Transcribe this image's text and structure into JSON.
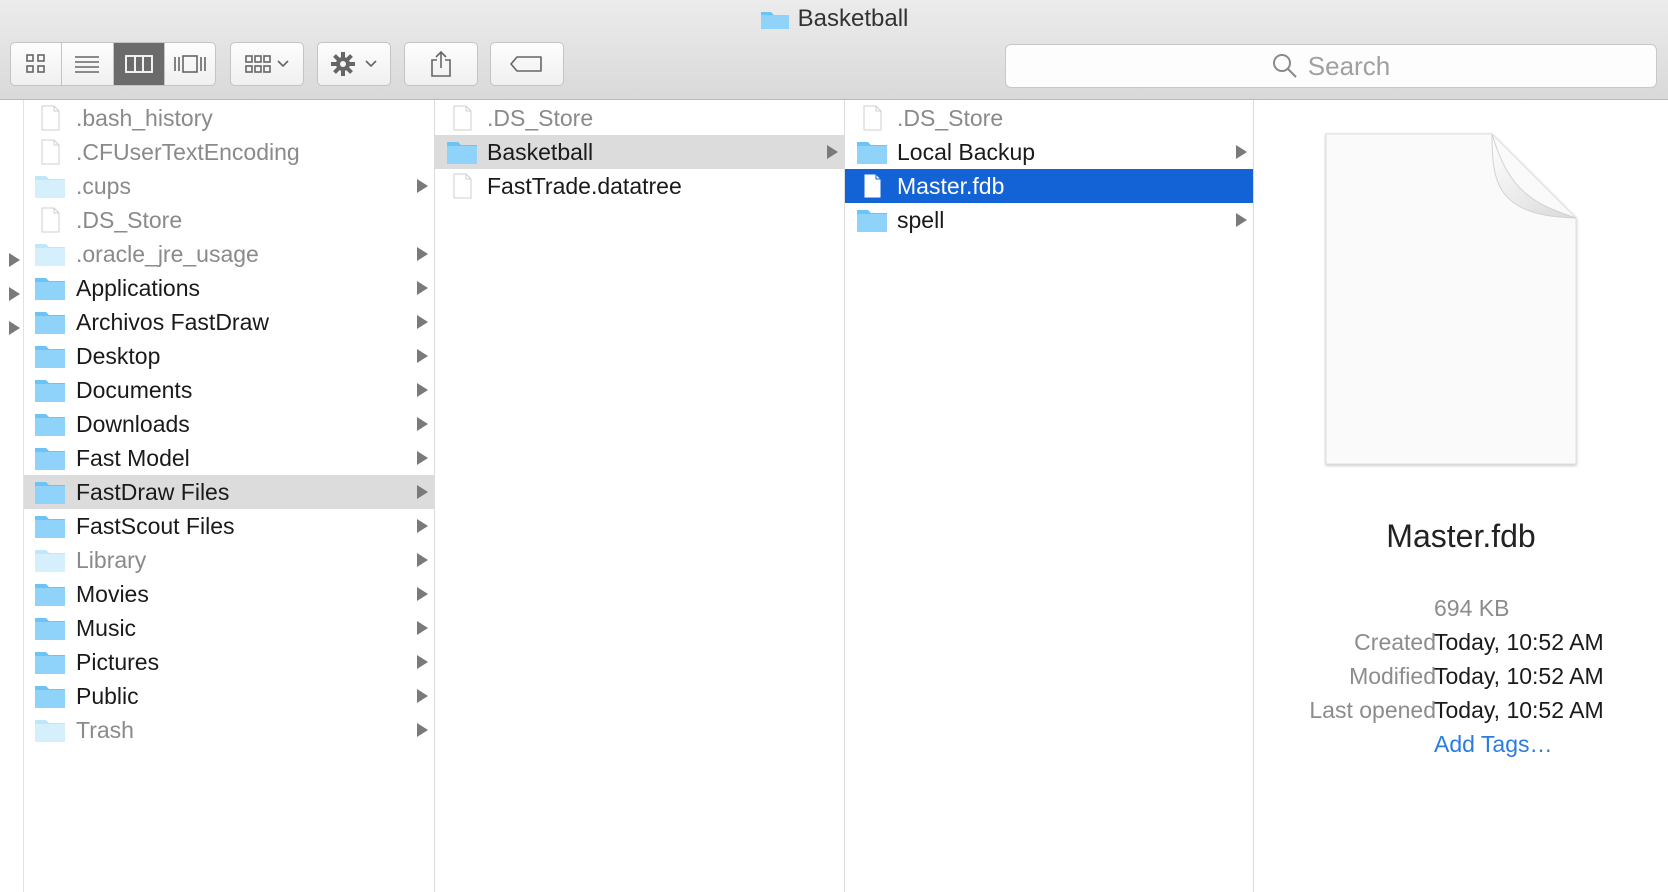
{
  "window": {
    "title": "Basketball"
  },
  "toolbar": {
    "view_buttons": [
      "icon-view",
      "list-view",
      "column-view",
      "cover-flow-view"
    ],
    "active_view": 2,
    "search_placeholder": "Search"
  },
  "columns": [
    {
      "items": [
        {
          "label": ".bash_history",
          "kind": "file",
          "dim": true,
          "arrow": false
        },
        {
          "label": ".CFUserTextEncoding",
          "kind": "file",
          "dim": true,
          "arrow": false
        },
        {
          "label": ".cups",
          "kind": "folder",
          "dim": true,
          "arrow": true
        },
        {
          "label": ".DS_Store",
          "kind": "file",
          "dim": true,
          "arrow": false
        },
        {
          "label": ".oracle_jre_usage",
          "kind": "folder",
          "dim": true,
          "arrow": true
        },
        {
          "label": "Applications",
          "kind": "folder",
          "arrow": true
        },
        {
          "label": "Archivos FastDraw",
          "kind": "folder",
          "arrow": true
        },
        {
          "label": "Desktop",
          "kind": "folder",
          "arrow": true
        },
        {
          "label": "Documents",
          "kind": "folder",
          "arrow": true
        },
        {
          "label": "Downloads",
          "kind": "folder",
          "arrow": true
        },
        {
          "label": "Fast Model",
          "kind": "folder",
          "arrow": true
        },
        {
          "label": "FastDraw Files",
          "kind": "folder",
          "arrow": true,
          "selected": "grey"
        },
        {
          "label": "FastScout Files",
          "kind": "folder",
          "arrow": true
        },
        {
          "label": "Library",
          "kind": "folder",
          "dim": true,
          "arrow": true
        },
        {
          "label": "Movies",
          "kind": "folder",
          "arrow": true
        },
        {
          "label": "Music",
          "kind": "folder",
          "arrow": true
        },
        {
          "label": "Pictures",
          "kind": "folder",
          "arrow": true
        },
        {
          "label": "Public",
          "kind": "folder",
          "arrow": true
        },
        {
          "label": "Trash",
          "kind": "folder",
          "dim": true,
          "arrow": true
        }
      ]
    },
    {
      "items": [
        {
          "label": ".DS_Store",
          "kind": "file",
          "dim": true,
          "arrow": false
        },
        {
          "label": "Basketball",
          "kind": "folder",
          "arrow": true,
          "selected": "grey"
        },
        {
          "label": "FastTrade.datatree",
          "kind": "file",
          "arrow": false
        }
      ]
    },
    {
      "items": [
        {
          "label": ".DS_Store",
          "kind": "file",
          "dim": true,
          "arrow": false
        },
        {
          "label": "Local Backup",
          "kind": "folder",
          "arrow": true
        },
        {
          "label": "Master.fdb",
          "kind": "file",
          "arrow": false,
          "selected": "blue"
        },
        {
          "label": "spell",
          "kind": "folder",
          "arrow": true
        }
      ]
    }
  ],
  "preview": {
    "name": "Master.fdb",
    "size": "694 KB",
    "created_label": "Created",
    "created": "Today, 10:52 AM",
    "modified_label": "Modified",
    "modified": "Today, 10:52 AM",
    "last_opened_label": "Last opened",
    "last_opened": "Today, 10:52 AM",
    "add_tags": "Add Tags…"
  },
  "colors": {
    "selection_blue": "#1363d6",
    "folder_blue": "#6cc3f5",
    "link_blue": "#2b7be0"
  }
}
